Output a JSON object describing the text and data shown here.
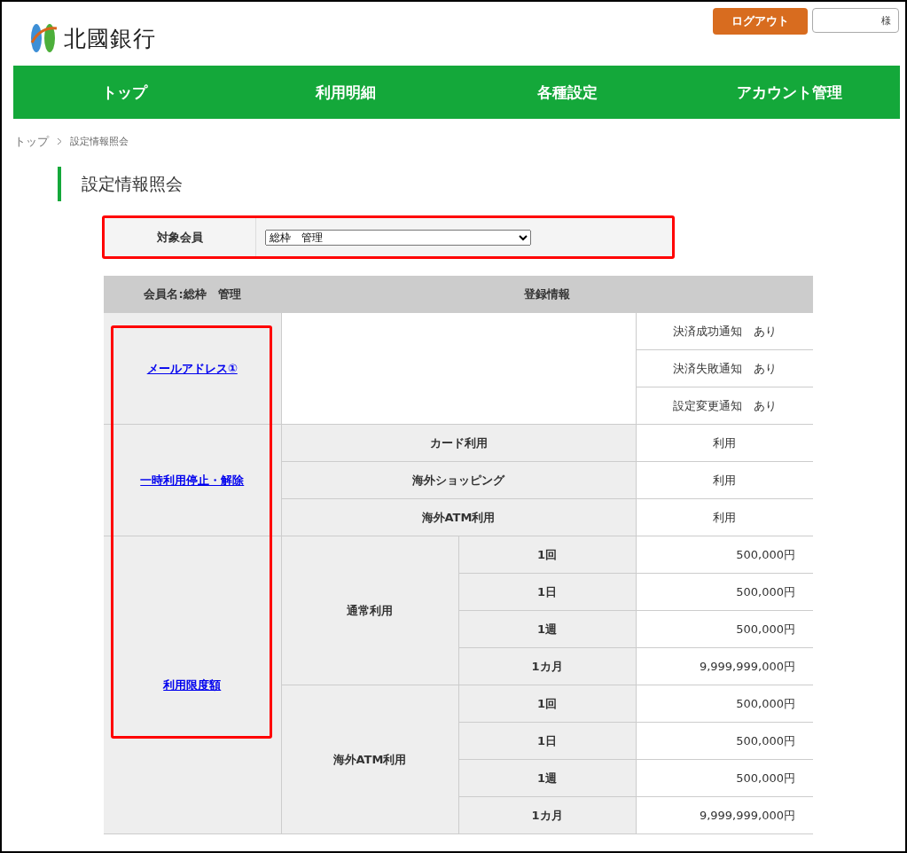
{
  "header": {
    "logo_text": "北國銀行",
    "logout_button": "ログアウト",
    "user_suffix": "様"
  },
  "nav": [
    "トップ",
    "利用明細",
    "各種設定",
    "アカウント管理"
  ],
  "breadcrumb": [
    "トップ",
    "設定情報照会"
  ],
  "page_title": "設定情報照会",
  "member_select": {
    "label": "対象会員",
    "value": "総枠　管理"
  },
  "table": {
    "header": {
      "member": "会員名:総枠　管理",
      "info": "登録情報"
    },
    "email": {
      "link": "メールアドレス①",
      "notifications": [
        "決済成功通知　あり",
        "決済失敗通知　あり",
        "設定変更通知　あり"
      ]
    },
    "pause": {
      "link": "一時利用停止・解除",
      "rows": [
        {
          "label": "カード利用",
          "value": "利用"
        },
        {
          "label": "海外ショッピング",
          "value": "利用"
        },
        {
          "label": "海外ATM利用",
          "value": "利用"
        }
      ]
    },
    "limits": {
      "link": "利用限度額",
      "groups": [
        {
          "label": "通常利用",
          "rows": [
            {
              "period": "1回",
              "amount": "500,000円"
            },
            {
              "period": "1日",
              "amount": "500,000円"
            },
            {
              "period": "1週",
              "amount": "500,000円"
            },
            {
              "period": "1カ月",
              "amount": "9,999,999,000円"
            }
          ]
        },
        {
          "label": "海外ATM利用",
          "rows": [
            {
              "period": "1回",
              "amount": "500,000円"
            },
            {
              "period": "1日",
              "amount": "500,000円"
            },
            {
              "period": "1週",
              "amount": "500,000円"
            },
            {
              "period": "1カ月",
              "amount": "9,999,999,000円"
            }
          ]
        }
      ]
    }
  }
}
